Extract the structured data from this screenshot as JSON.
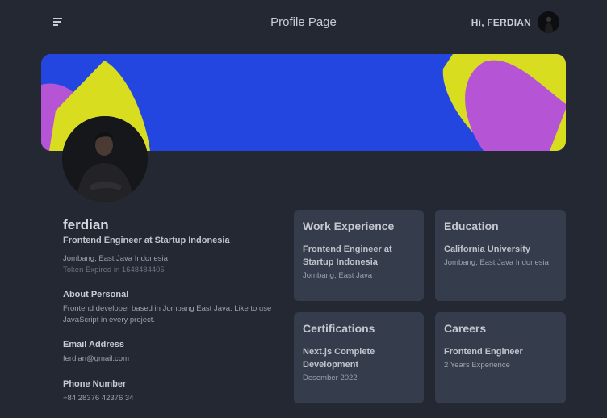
{
  "header": {
    "title": "Profile Page",
    "greeting": "Hi, FERDIAN"
  },
  "profile": {
    "name": "ferdian",
    "role": "Frontend Engineer at Startup Indonesia",
    "location": "Jombang, East Java Indonesia",
    "token": "Token Expired in 1648484405"
  },
  "about": {
    "title": "About Personal",
    "text": "Frontend developer based in Jombang East Java. Like to use JavaScript in every project."
  },
  "email": {
    "title": "Email Address",
    "value": "ferdian@gmail.com"
  },
  "phone": {
    "title": "Phone Number",
    "value": "+84 28376 42376 34"
  },
  "cards": {
    "work": {
      "title": "Work Experience",
      "subtitle": "Frontend Engineer at Startup Indonesia",
      "meta": "Jombang, East Java"
    },
    "education": {
      "title": "Education",
      "subtitle": "California University",
      "meta": "Jombang, East Java Indonesia"
    },
    "certifications": {
      "title": "Certifications",
      "subtitle": "Next.js Complete Development",
      "meta": "Desember 2022"
    },
    "careers": {
      "title": "Careers",
      "subtitle": "Frontend Engineer",
      "meta": "2 Years Experience"
    }
  },
  "colors": {
    "background": "#232833",
    "card": "#353d4c",
    "banner_blue": "#2346e0",
    "banner_yellow": "#d8de1f",
    "banner_purple": "#b555d6"
  }
}
